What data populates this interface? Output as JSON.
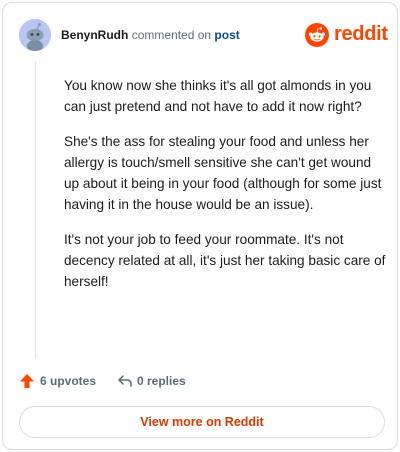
{
  "header": {
    "author": "BenynRudh",
    "action_text": "commented on",
    "target_link": "post",
    "logo_text": "reddit"
  },
  "comment": {
    "paragraphs": [
      "You know now she thinks it's all got almonds in you can just pretend and not have to add it now right?",
      "She's the ass for stealing your food and unless her allergy is touch/smell sensitive she can't get wound up about it being in your food (although for some just having it in the house would be an issue).",
      "It's not your job to feed your roommate. It's not decency related at all, it's just her taking basic care of herself!"
    ]
  },
  "actions": {
    "upvotes": "6 upvotes",
    "replies": "0 replies"
  },
  "footer": {
    "view_more": "View more on Reddit"
  },
  "colors": {
    "brand": "#ff4500",
    "upvote_arrow": "#ff4500",
    "link": "#0a4b8c",
    "avatar_bg": "#b8c6f2"
  },
  "icons": {
    "avatar": "snoo-avatar",
    "logo": "reddit-snoo-icon",
    "upvote": "upvote-arrow-icon",
    "reply": "reply-arrow-icon"
  }
}
